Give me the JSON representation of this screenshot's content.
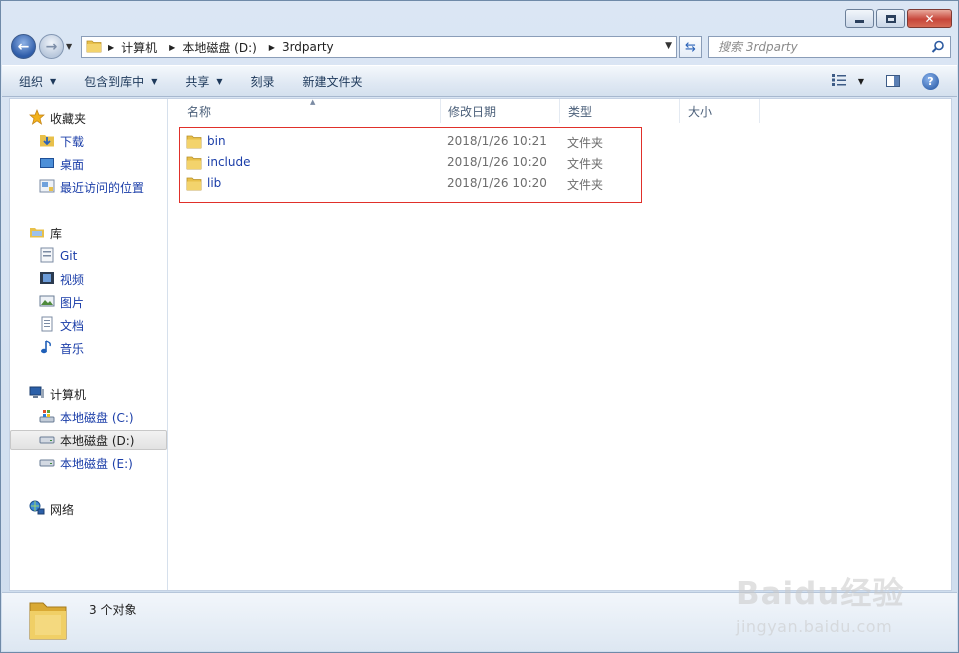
{
  "window": {
    "close_glyph": "✕"
  },
  "address": {
    "crumbs": [
      "计算机",
      "本地磁盘 (D:)",
      "3rdparty"
    ]
  },
  "search": {
    "placeholder": "搜索 3rdparty"
  },
  "toolbar": {
    "organize": "组织",
    "include_in_library": "包含到库中",
    "share": "共享",
    "burn": "刻录",
    "new_folder": "新建文件夹"
  },
  "sidebar": {
    "favorites": {
      "label": "收藏夹",
      "items": [
        "下载",
        "桌面",
        "最近访问的位置"
      ]
    },
    "libraries": {
      "label": "库",
      "items": [
        "Git",
        "视频",
        "图片",
        "文档",
        "音乐"
      ]
    },
    "computer": {
      "label": "计算机",
      "items": [
        "本地磁盘 (C:)",
        "本地磁盘 (D:)",
        "本地磁盘 (E:)"
      ],
      "selected": "本地磁盘 (D:)"
    },
    "network": {
      "label": "网络"
    }
  },
  "columns": {
    "name": "名称",
    "modified": "修改日期",
    "type": "类型",
    "size": "大小"
  },
  "files": [
    {
      "name": "bin",
      "modified": "2018/1/26 10:21",
      "type": "文件夹"
    },
    {
      "name": "include",
      "modified": "2018/1/26 10:20",
      "type": "文件夹"
    },
    {
      "name": "lib",
      "modified": "2018/1/26 10:20",
      "type": "文件夹"
    }
  ],
  "status": {
    "count_text": "3 个对象"
  },
  "watermark": {
    "brand": "Baidu经验",
    "url": "jingyan.baidu.com"
  },
  "colors": {
    "link": "#1a3da8",
    "highlight_border": "#e0302a",
    "folder": "#e8c04a"
  }
}
